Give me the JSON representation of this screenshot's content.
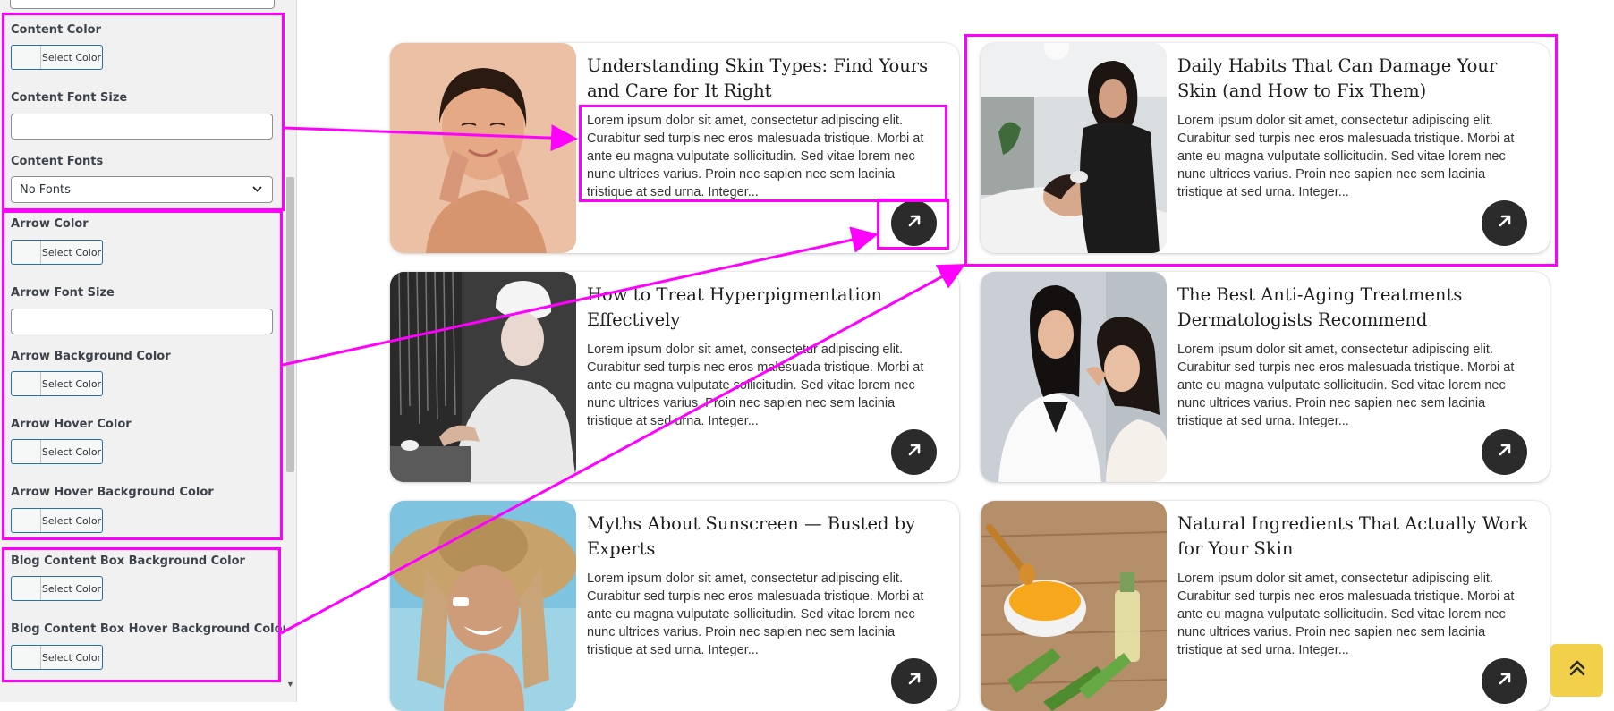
{
  "sidebar": {
    "content_color_label": "Content Color",
    "content_font_size_label": "Content Font Size",
    "content_fonts_label": "Content Fonts",
    "content_fonts_value": "No Fonts",
    "arrow_color_label": "Arrow Color",
    "arrow_font_size_label": "Arrow Font Size",
    "arrow_bg_color_label": "Arrow Background Color",
    "arrow_hover_color_label": "Arrow Hover Color",
    "arrow_hover_bg_color_label": "Arrow Hover Background Color",
    "blog_box_bg_color_label": "Blog Content Box Background Color",
    "blog_box_hover_bg_color_label": "Blog Content Box Hover Background Color",
    "select_color": "Select Color"
  },
  "posts": [
    {
      "title": "Understanding Skin Types: Find Yours and Care for It Right",
      "excerpt": "Lorem ipsum dolor sit amet, consectetur adipiscing elit. Curabitur sed turpis nec eros malesuada tristique. Morbi at ante eu magna vulputate sollicitudin. Sed vitae lorem nec nunc ultrices varius. Proin nec sapien nec sem lacinia tristique at sed urna. Integer..."
    },
    {
      "title": "Daily Habits That Can Damage Your Skin (and How to Fix Them)",
      "excerpt": "Lorem ipsum dolor sit amet, consectetur adipiscing elit. Curabitur sed turpis nec eros malesuada tristique. Morbi at ante eu magna vulputate sollicitudin. Sed vitae lorem nec nunc ultrices varius. Proin nec sapien nec sem lacinia tristique at sed urna. Integer..."
    },
    {
      "title": "How to Treat Hyperpigmentation Effectively",
      "excerpt": "Lorem ipsum dolor sit amet, consectetur adipiscing elit. Curabitur sed turpis nec eros malesuada tristique. Morbi at ante eu magna vulputate sollicitudin. Sed vitae lorem nec nunc ultrices varius. Proin nec sapien nec sem lacinia tristique at sed urna. Integer..."
    },
    {
      "title": "The Best Anti-Aging Treatments Dermatologists Recommend",
      "excerpt": "Lorem ipsum dolor sit amet, consectetur adipiscing elit. Curabitur sed turpis nec eros malesuada tristique. Morbi at ante eu magna vulputate sollicitudin. Sed vitae lorem nec nunc ultrices varius. Proin nec sapien nec sem lacinia tristique at sed urna. Integer..."
    },
    {
      "title": "Myths About Sunscreen — Busted by Experts",
      "excerpt": "Lorem ipsum dolor sit amet, consectetur adipiscing elit. Curabitur sed turpis nec eros malesuada tristique. Morbi at ante eu magna vulputate sollicitudin. Sed vitae lorem nec nunc ultrices varius. Proin nec sapien nec sem lacinia tristique at sed urna. Integer..."
    },
    {
      "title": "Natural Ingredients That Actually Work for Your Skin",
      "excerpt": "Lorem ipsum dolor sit amet, consectetur adipiscing elit. Curabitur sed turpis nec eros malesuada tristique. Morbi at ante eu magna vulputate sollicitudin. Sed vitae lorem nec nunc ultrices varius. Proin nec sapien nec sem lacinia tristique at sed urna. Integer..."
    }
  ],
  "colors": {
    "highlight": "#ff00ff",
    "arrow_button_bg": "#2b2b2b",
    "scroll_top_bg": "#f3d04a",
    "select_border": "#2271b1"
  },
  "icons": {
    "arrow": "arrow-up-right-icon",
    "scroll_top": "double-chevron-up-icon",
    "dropdown": "chevron-down-icon"
  }
}
